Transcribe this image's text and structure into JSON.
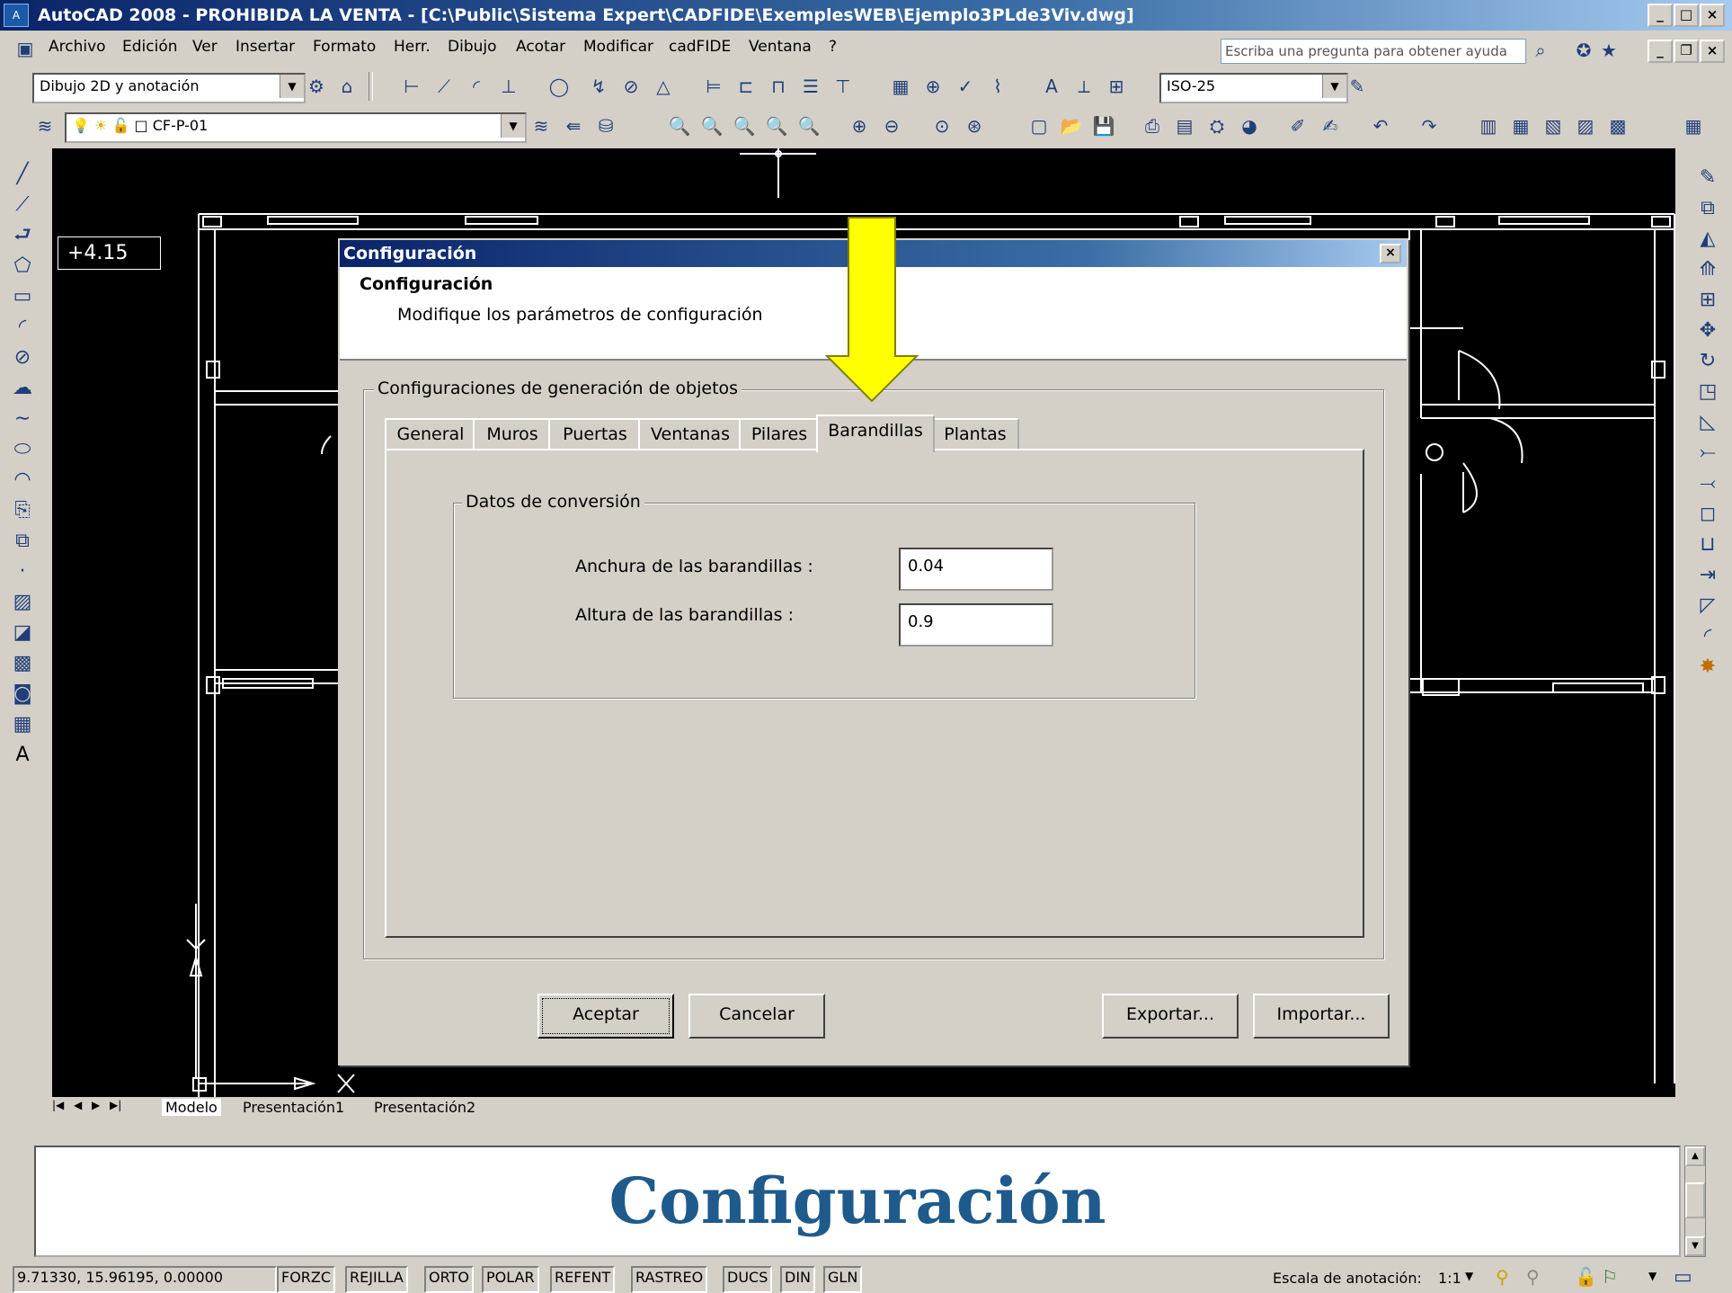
{
  "window": {
    "title": "AutoCAD 2008 - PROHIBIDA LA VENTA - [C:\\Public\\Sistema Expert\\CADFIDE\\ExemplesWEB\\Ejemplo3PLde3Viv.dwg]",
    "app_icon_label": "A"
  },
  "menu": {
    "items": [
      "Archivo",
      "Edición",
      "Ver",
      "Insertar",
      "Formato",
      "Herr.",
      "Dibujo",
      "Acotar",
      "Modificar",
      "cadFIDE",
      "Ventana",
      "?"
    ],
    "help_placeholder": "Escriba una pregunta para obtener ayuda"
  },
  "toolbar": {
    "workspace": "Dibujo 2D y anotación",
    "dimstyle": "ISO-25",
    "layer": "CF-P-01"
  },
  "drawing": {
    "elevation_label": "+4.15",
    "background": "#000000",
    "line_color": "#ffffff"
  },
  "dialog": {
    "title": "Configuración",
    "header_title": "Configuración",
    "header_subtitle": "Modifique los parámetros de configuración",
    "group_label": "Configuraciones de generación de objetos",
    "tabs": [
      "General",
      "Muros",
      "Puertas",
      "Ventanas",
      "Pilares",
      "Barandillas",
      "Plantas"
    ],
    "active_tab": "Barandillas",
    "conversion_group": "Datos de conversión",
    "fields": [
      {
        "label": "Anchura de las barandillas :",
        "value": "0.04"
      },
      {
        "label": "Altura de las barandillas :",
        "value": "0.9"
      }
    ],
    "buttons": {
      "accept": "Aceptar",
      "cancel": "Cancelar",
      "export": "Exportar...",
      "import": "Importar..."
    }
  },
  "annotation": {
    "arrow_color": "#ffff00"
  },
  "layout_tabs": [
    "Modelo",
    "Presentación1",
    "Presentación2"
  ],
  "command": {
    "caption": "Configuración",
    "caption_color": "#1f5a8c"
  },
  "status": {
    "coordinates": "9.71330, 15.96195, 0.00000",
    "toggles": [
      "FORZC",
      "REJILLA",
      "ORTO",
      "POLAR",
      "REFENT",
      "RASTREO",
      "DUCS",
      "DIN",
      "GLN"
    ],
    "annotation_scale_label": "Escala de anotación:",
    "annotation_scale_value": "1:1"
  }
}
